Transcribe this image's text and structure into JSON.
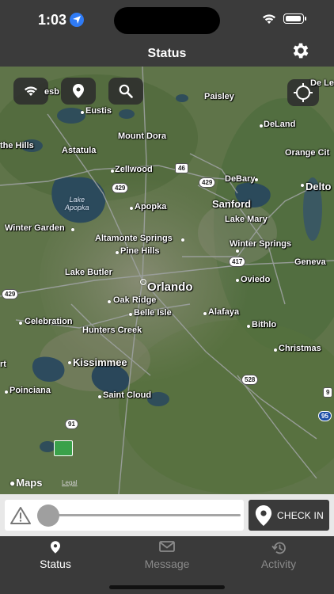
{
  "status_bar": {
    "time": "1:03"
  },
  "header": {
    "title": "Status"
  },
  "map": {
    "attribution": "Maps",
    "legal": "Legal",
    "places": {
      "eustis": "Eustis",
      "mount_dora": "Mount Dora",
      "paisley": "Paisley",
      "deland": "DeLand",
      "de_le": "De Le",
      "the_hills": "the Hills",
      "astatula": "Astatula",
      "orange_city": "Orange Cit",
      "zellwood": "Zellwood",
      "debary": "DeBary",
      "delto": "Delto",
      "lake_apopka": "Lake\nApopka",
      "apopka": "Apopka",
      "sanford": "Sanford",
      "lake_mary": "Lake Mary",
      "winter_garden": "Winter Garden",
      "altamonte_springs": "Altamonte Springs",
      "winter_springs": "Winter Springs",
      "pine_hills": "Pine Hills",
      "geneva": "Geneva",
      "lake_butler": "Lake Butler",
      "orlando": "Orlando",
      "oviedo": "Oviedo",
      "oak_ridge": "Oak Ridge",
      "belle_isle": "Belle Isle",
      "alafaya": "Alafaya",
      "celebration": "Celebration",
      "hunters_creek": "Hunters Creek",
      "bithlo": "Bithlo",
      "christmas": "Christmas",
      "kissimmee": "Kissimmee",
      "rt": "rt",
      "poinciana": "Poinciana",
      "saint_cloud": "Saint Cloud",
      "esb": "esb"
    },
    "road_shields": {
      "r46": "46",
      "r429a": "429",
      "r429b": "429",
      "r417": "417",
      "r429c": "429",
      "r528": "528",
      "r91": "91",
      "r95": "95",
      "r9": "9"
    }
  },
  "controls": {
    "slider_value": 0,
    "checkin_label": "CHECK IN"
  },
  "tabs": [
    {
      "label": "Status",
      "icon": "map-pin-icon",
      "active": true
    },
    {
      "label": "Message",
      "icon": "envelope-icon",
      "active": false
    },
    {
      "label": "Activity",
      "icon": "history-icon",
      "active": false
    }
  ],
  "colors": {
    "bar": "#3a3a3a",
    "active_tab": "#ffffff",
    "inactive_tab": "#8a8a8a",
    "location_accent": "#2f7bf5"
  }
}
